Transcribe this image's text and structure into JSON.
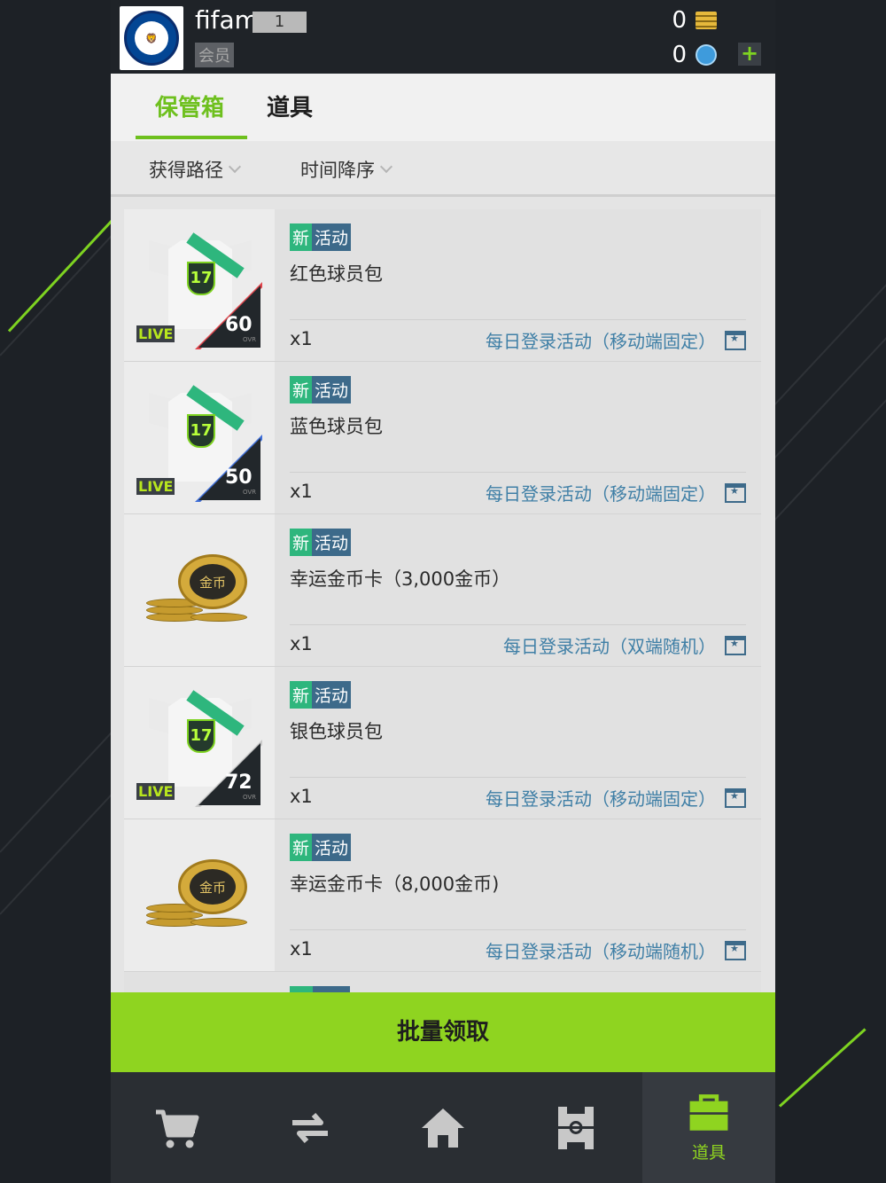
{
  "header": {
    "username": "fifam",
    "level": "1",
    "member_label": "会员",
    "gold": "0",
    "points": "0",
    "plus_label": "+"
  },
  "tabs": [
    {
      "label": "保管箱",
      "active": true
    },
    {
      "label": "道具",
      "active": false
    }
  ],
  "filters": [
    {
      "label": "获得路径"
    },
    {
      "label": "时间降序"
    }
  ],
  "tags": {
    "new": "新",
    "activity": "活动"
  },
  "items": [
    {
      "type": "shirt",
      "name": "红色球员包",
      "qty": "x1",
      "source": "每日登录活动（移动端固定）",
      "ovr": "60",
      "live": "LIVE",
      "badge": "17",
      "ovr_label": "OVR",
      "edge_color": "#e0454c"
    },
    {
      "type": "shirt",
      "name": "蓝色球员包",
      "qty": "x1",
      "source": "每日登录活动（移动端固定）",
      "ovr": "50",
      "live": "LIVE",
      "badge": "17",
      "ovr_label": "OVR",
      "edge_color": "#3f6fd8"
    },
    {
      "type": "coin",
      "name": "幸运金币卡（3,000金币）",
      "qty": "x1",
      "source": "每日登录活动（双端随机）",
      "coin_face": "金币"
    },
    {
      "type": "shirt",
      "name": "银色球员包",
      "qty": "x1",
      "source": "每日登录活动（移动端固定）",
      "ovr": "72",
      "live": "LIVE",
      "badge": "17",
      "ovr_label": "OVR",
      "edge_color": "#c9c9c9"
    },
    {
      "type": "coin",
      "name": "幸运金币卡（8,000金币)",
      "qty": "x1",
      "source": "每日登录活动（移动端随机）",
      "coin_face": "金币"
    }
  ],
  "claim_button": "批量领取",
  "nav": [
    {
      "icon": "cart-icon",
      "label": ""
    },
    {
      "icon": "transfer-icon",
      "label": ""
    },
    {
      "icon": "home-icon",
      "label": ""
    },
    {
      "icon": "pitch-icon",
      "label": ""
    },
    {
      "icon": "bag-icon",
      "label": "道具",
      "active": true
    }
  ],
  "colors": {
    "accent": "#8fd420",
    "tab_active": "#6ec01e",
    "tag_new": "#2eb67d",
    "tag_activity": "#3d6a8a",
    "source_text": "#3f7fa6"
  }
}
